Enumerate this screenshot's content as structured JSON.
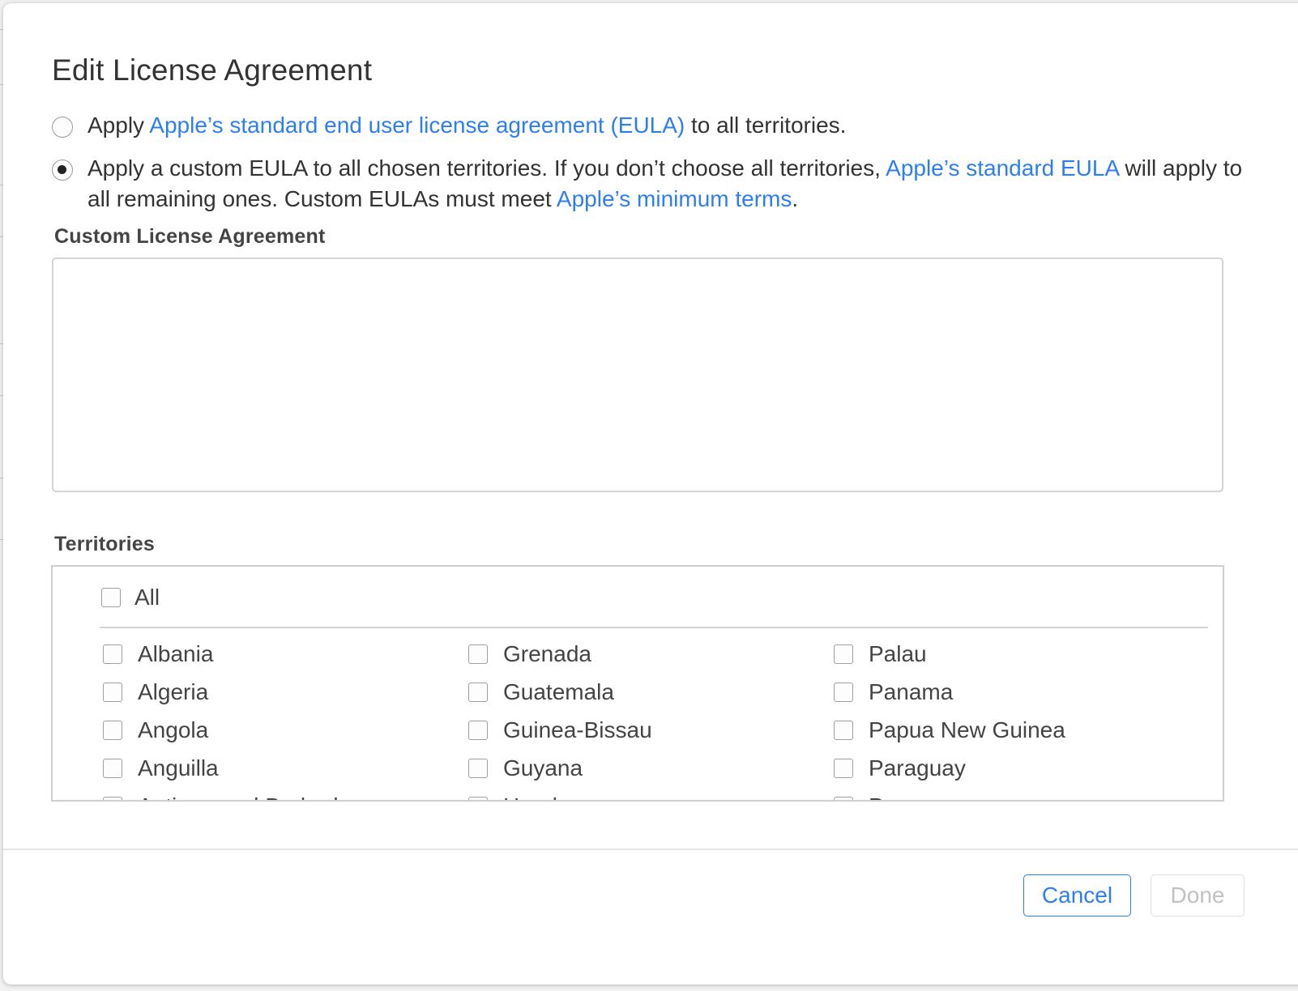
{
  "dialog": {
    "title": "Edit License Agreement",
    "options": [
      {
        "selected": false,
        "text_before": "Apply ",
        "link": "Apple’s standard end user license agreement (EULA)",
        "text_after": " to all territories."
      },
      {
        "selected": true,
        "text_1": "Apply a custom EULA to all chosen territories. If you don’t choose all territories, ",
        "link_1": "Apple’s standard EULA",
        "text_2": " will apply to all remaining ones. Custom EULAs must meet ",
        "link_2": "Apple’s minimum terms",
        "text_3": "."
      }
    ],
    "custom_label": "Custom License Agreement",
    "custom_value": "",
    "territories_label": "Territories",
    "all_label": "All",
    "columns": [
      [
        "Albania",
        "Algeria",
        "Angola",
        "Anguilla",
        "Antigua and Barbuda"
      ],
      [
        "Grenada",
        "Guatemala",
        "Guinea-Bissau",
        "Guyana",
        "Honduras"
      ],
      [
        "Palau",
        "Panama",
        "Papua New Guinea",
        "Paraguay",
        "Peru"
      ]
    ],
    "cancel_label": "Cancel",
    "done_label": "Done"
  },
  "colors": {
    "link": "#2d7ff0",
    "text": "#333333",
    "disabled": "#c2c2c2"
  }
}
